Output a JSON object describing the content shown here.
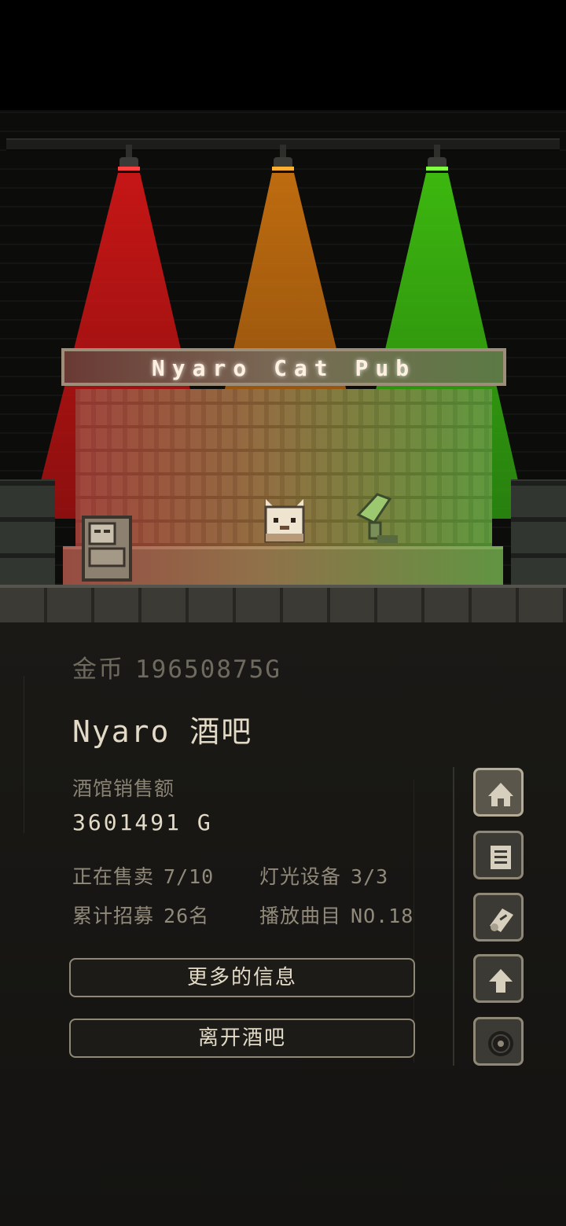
{
  "scene": {
    "sign_text": "Nyaro Cat Pub",
    "light_colors": [
      "#e02020",
      "#e08a10",
      "#44d010"
    ]
  },
  "currency": {
    "label": "金币",
    "value": "19650875G"
  },
  "pub": {
    "name": "Nyaro 酒吧",
    "sales_label": "酒馆销售额",
    "sales_value": "3601491 G"
  },
  "stats": {
    "selling_label": "正在售卖",
    "selling_value": "7/10",
    "lighting_label": "灯光设备",
    "lighting_value": "3/3",
    "recruited_label": "累计招募",
    "recruited_value": "26名",
    "track_label": "播放曲目",
    "track_value": "NO.18"
  },
  "buttons": {
    "more_info": "更多的信息",
    "leave": "离开酒吧"
  },
  "side_buttons": [
    "house-icon",
    "menu-list-icon",
    "scroll-icon",
    "arrow-up-icon",
    "record-disc-icon"
  ]
}
